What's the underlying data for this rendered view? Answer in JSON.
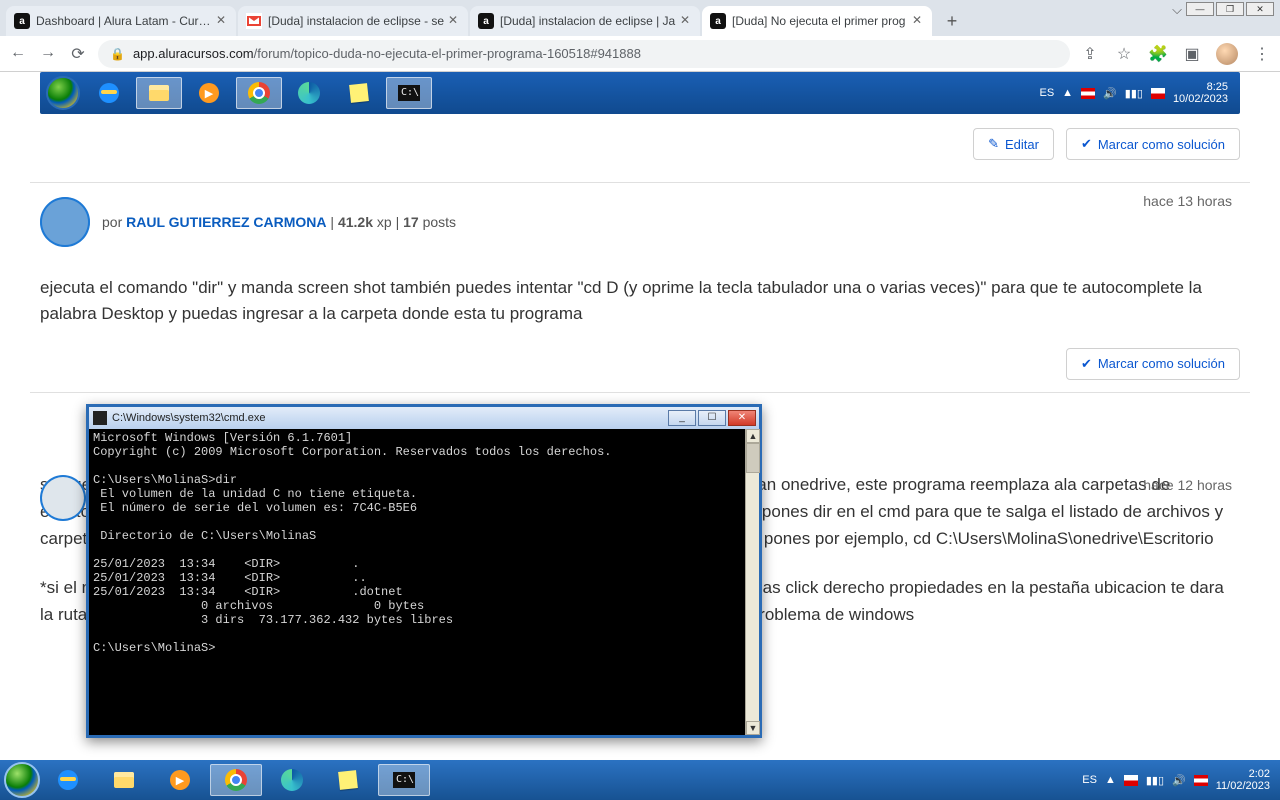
{
  "window": {
    "min": "—",
    "max": "❐",
    "close": "✕",
    "dropdown": "⌵"
  },
  "tabs": [
    {
      "favClass": "fav-a",
      "favText": "a",
      "title": "Dashboard | Alura Latam - Cursos"
    },
    {
      "favClass": "",
      "favText": "",
      "title": "[Duda] instalacion de eclipse - se"
    },
    {
      "favClass": "fav-a",
      "favText": "a",
      "title": "[Duda] instalacion de eclipse | Ja"
    },
    {
      "favClass": "fav-a",
      "favText": "a",
      "title": "[Duda] No ejecuta el primer prog",
      "active": true
    }
  ],
  "newTab": "+",
  "nav": {
    "back": "←",
    "fwd": "→",
    "reload": "⟳"
  },
  "addr": {
    "lock": "🔒",
    "host": "app.aluracursos.com",
    "path": "/forum/topico-duda-no-ejecuta-el-primer-programa-160518#941888"
  },
  "addrActions": {
    "share": "⇪",
    "star": "☆",
    "ext": "🧩",
    "tabs": "▣",
    "menu": "⋮"
  },
  "embedTaskbar": {
    "tray": {
      "lang": "ES",
      "up": "▲",
      "flag": "flag",
      "vol": "🔊",
      "net": "▮▮▯",
      "time": "8:25",
      "date": "10/02/2023"
    }
  },
  "actions": {
    "edit": "Editar",
    "mark": "Marcar como solución",
    "editIcon": "✎",
    "markIcon": "✔"
  },
  "post2": {
    "timestamp": "hace 13 horas",
    "by": "por ",
    "author": "RAUL GUTIERREZ CARMONA",
    "xp": "41.2k",
    "xpSuffix": " xp",
    "posts": "17",
    "postsSuffix": " posts",
    "body": "ejecuta el comando \"dir\" y manda screen shot también puedes intentar \"cd D (y oprime la tecla tabulador una o varias veces)\" para que te autocomplete la palabra Desktop y puedas ingresar a la carpeta donde esta tu programa"
  },
  "post3": {
    "timestamp": "hace 12 horas",
    "body1": "se puede ver que en tu carpeta de usuario solo esta .dotnet, seguramente tienes instalado o usan onedrive, este programa reemplaza ala carpetas de escritorio y documentos, para llegar ahi debes poner cd C:\\Users\\MolinaS\\onedrive una vez ahi pones dir en el cmd para que te salga el listado de archivos y carpetas tipicamente aparece una que se llama escritorio o desktop, segun el nombre que veas pones por ejemplo, cd C:\\Users\\MolinaS\\onedrive\\Escritorio",
    "body2": "*si el nombre de la carpeta escritorio tuviera una \"ñ\" o caracter especial, localizas el archivo le das click derecho propiedades en la pestaña ubicacion te dara la ruta exacta de la carpeta, si ahi existen caracteres especiales ya se estaria hablando de un problema de windows"
  },
  "cmd": {
    "title": "C:\\Windows\\system32\\cmd.exe",
    "min": "_",
    "max": "☐",
    "close": "✕",
    "up": "▲",
    "down": "▼",
    "text": "Microsoft Windows [Versión 6.1.7601]\nCopyright (c) 2009 Microsoft Corporation. Reservados todos los derechos.\n\nC:\\Users\\MolinaS>dir\n El volumen de la unidad C no tiene etiqueta.\n El número de serie del volumen es: 7C4C-B5E6\n\n Directorio de C:\\Users\\MolinaS\n\n25/01/2023  13:34    <DIR>          .\n25/01/2023  13:34    <DIR>          ..\n25/01/2023  13:34    <DIR>          .dotnet\n               0 archivos              0 bytes\n               3 dirs  73.177.362.432 bytes libres\n\nC:\\Users\\MolinaS>"
  },
  "sysTaskbar": {
    "tray": {
      "lang": "ES",
      "up": "▲",
      "net": "▮▮▯",
      "vol": "🔊",
      "flag": "flag",
      "time": "2:02",
      "date": "11/02/2023"
    }
  }
}
